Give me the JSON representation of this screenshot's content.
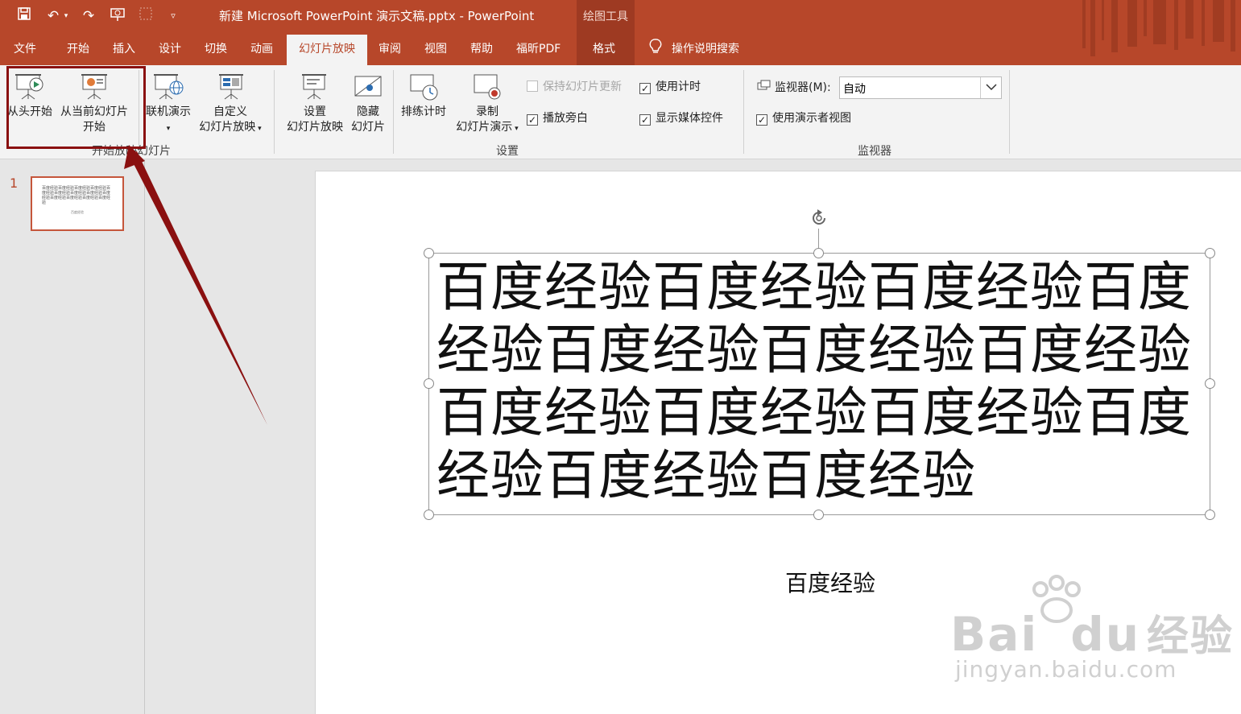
{
  "titlebar": {
    "doc_title": "新建 Microsoft PowerPoint 演示文稿.pptx  -  PowerPoint",
    "context_tools": "绘图工具"
  },
  "tabs": [
    "文件",
    "开始",
    "插入",
    "设计",
    "切换",
    "动画",
    "幻灯片放映",
    "审阅",
    "视图",
    "帮助",
    "福昕PDF",
    "格式"
  ],
  "active_tab": "幻灯片放映",
  "tell_me": "操作说明搜索",
  "ribbon": {
    "start_group": {
      "label": "开始放映幻灯片",
      "from_beginning": "从头开始",
      "from_current_1": "从当前幻灯片",
      "from_current_2": "开始",
      "online": "联机演示",
      "custom_1": "自定义",
      "custom_2": "幻灯片放映"
    },
    "setup_group": {
      "label": "设置",
      "setup_1": "设置",
      "setup_2": "幻灯片放映",
      "hide_1": "隐藏",
      "hide_2": "幻灯片",
      "rehearse": "排练计时",
      "record_1": "录制",
      "record_2": "幻灯片演示",
      "keep_updated": "保持幻灯片更新",
      "play_narrations": "播放旁白",
      "use_timings": "使用计时",
      "show_media": "显示媒体控件"
    },
    "monitor_group": {
      "label": "监视器",
      "monitor_label": "监视器(M):",
      "monitor_value": "自动",
      "presenter_view": "使用演示者视图"
    }
  },
  "thumbnail": {
    "number": "1",
    "body": "百度经验百度经验百度经验百度经验百度经验百度经验百度经验百度经验百度经验百度经验百度经验百度经验百度经验",
    "subtitle": "百度经验"
  },
  "slide": {
    "body_text": "百度经验百度经验百度经验百度经验百度经验百度经验百度经验百度经验百度经验百度经验百度经验百度经验百度经验",
    "subtitle": "百度经验"
  },
  "watermark": {
    "brand": "Bai",
    "brand2": "du",
    "brand_cn": "经验",
    "url": "jingyan.baidu.com"
  },
  "colors": {
    "accent": "#b7472a",
    "annotation": "#8a1010"
  }
}
